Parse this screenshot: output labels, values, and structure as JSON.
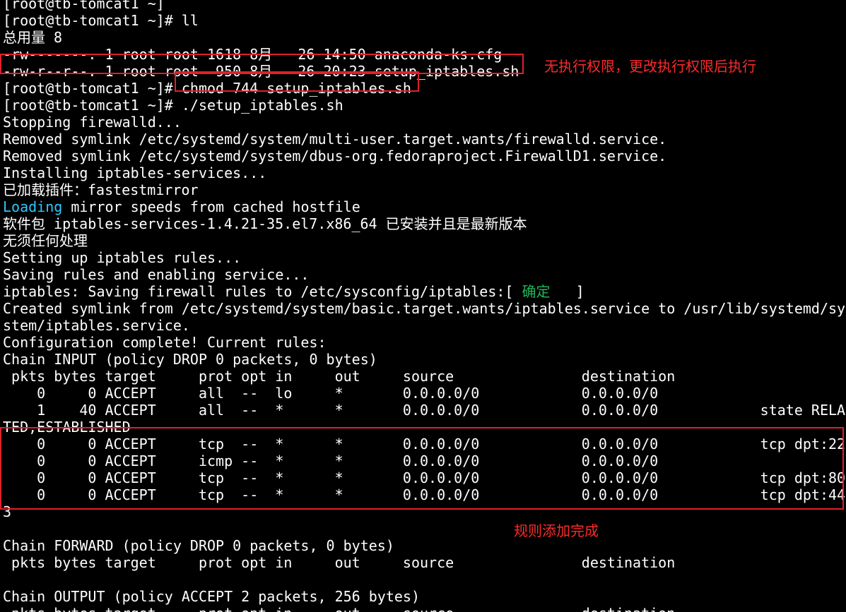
{
  "terminal": {
    "lines": [
      "[root@tb-tomcat1 ~]",
      "[root@tb-tomcat1 ~]# ll",
      "总用量 8",
      "-rw-------. 1 root root 1618 8月   26 14:50 anaconda-ks.cfg",
      "-rw-r--r--. 1 root root  950 8月   26 20:23 setup_iptables.sh",
      "[root@tb-tomcat1 ~]# chmod 744 setup_iptables.sh",
      "[root@tb-tomcat1 ~]# ./setup_iptables.sh",
      "Stopping firewalld...",
      "Removed symlink /etc/systemd/system/multi-user.target.wants/firewalld.service.",
      "Removed symlink /etc/systemd/system/dbus-org.fedoraproject.FirewallD1.service.",
      "Installing iptables-services...",
      "已加载插件：fastestmirror",
      "mirror speeds from cached hostfile",
      "软件包 iptables-services-1.4.21-35.el7.x86_64 已安装并且是最新版本",
      "无须任何处理",
      "Setting up iptables rules...",
      "Saving rules and enabling service...",
      "iptables: Saving firewall rules to /etc/sysconfig/iptables:[ ",
      "Created symlink from /etc/systemd/system/basic.target.wants/iptables.service to /usr/lib/systemd/sy",
      "stem/iptables.service.",
      "Configuration complete! Current rules:",
      "Chain INPUT (policy DROP 0 packets, 0 bytes)",
      " pkts bytes target     prot opt in     out     source               destination",
      "    0     0 ACCEPT     all  --  lo     *       0.0.0.0/0            0.0.0.0/0",
      "    1    40 ACCEPT     all  --  *      *       0.0.0.0/0            0.0.0.0/0            state RELA",
      "TED,ESTABLISHED",
      "    0     0 ACCEPT     tcp  --  *      *       0.0.0.0/0            0.0.0.0/0            tcp dpt:22",
      "    0     0 ACCEPT     icmp --  *      *       0.0.0.0/0            0.0.0.0/0",
      "    0     0 ACCEPT     tcp  --  *      *       0.0.0.0/0            0.0.0.0/0            tcp dpt:80",
      "    0     0 ACCEPT     tcp  --  *      *       0.0.0.0/0            0.0.0.0/0            tcp dpt:44",
      "3",
      "",
      "Chain FORWARD (policy DROP 0 packets, 0 bytes)",
      " pkts bytes target     prot opt in     out     source               destination",
      "",
      "Chain OUTPUT (policy ACCEPT 2 packets, 256 bytes)",
      " pkts bytes target     prot opt in     out     source               destination"
    ],
    "loading_word": "Loading",
    "status_ok": "确定",
    "status_close": "   ]",
    "colors": {
      "background": "#000000",
      "text": "#ffffff",
      "loading": "#2ec7ff",
      "ok": "#1fb75a",
      "annotation": "#ff2a2a"
    }
  },
  "annotations": {
    "no_permission": "无执行权限，更改执行权限后执行",
    "rules_added": "规则添加完成"
  }
}
